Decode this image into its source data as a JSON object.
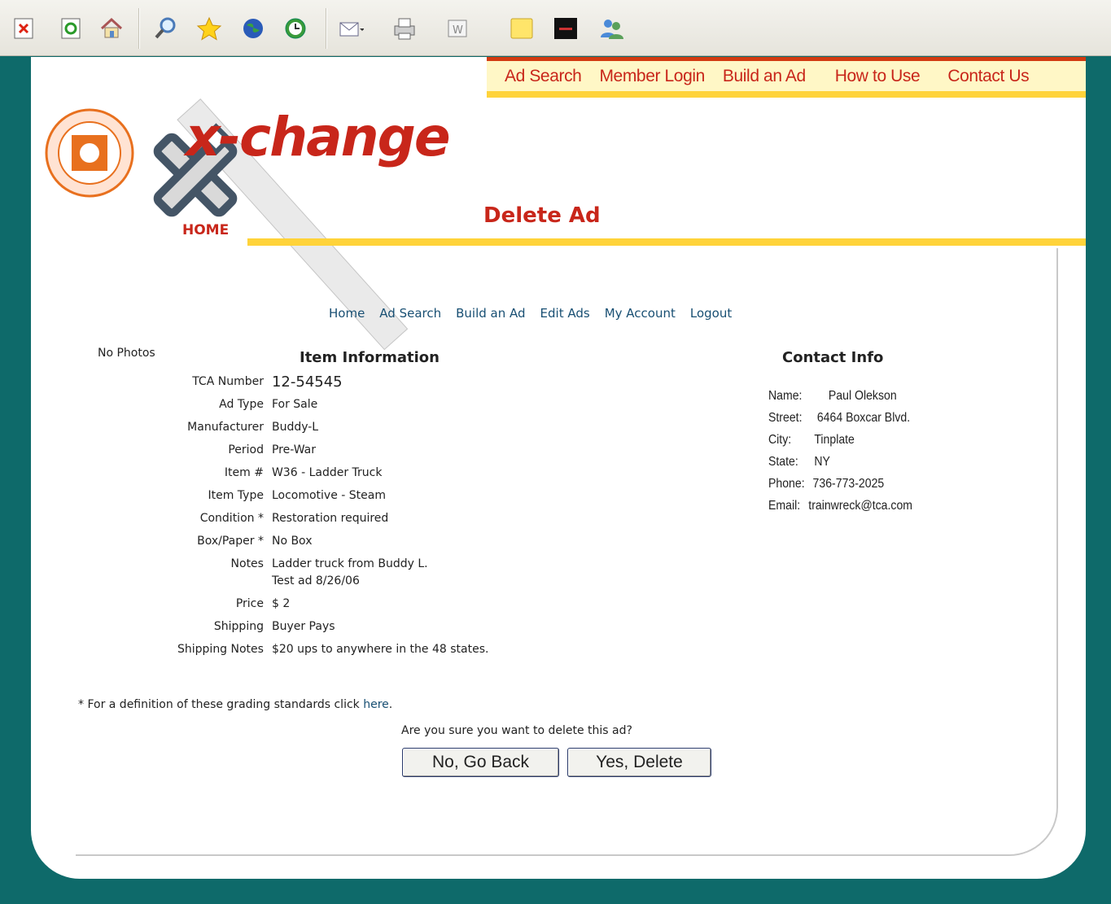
{
  "toolbar": {
    "icons": [
      "stop-icon",
      "refresh-icon",
      "home-icon",
      "search-icon",
      "favorites-icon",
      "media-icon",
      "history-icon",
      "mail-icon",
      "print-icon",
      "edit-icon",
      "notes-icon",
      "messenger-icon",
      "contacts-icon"
    ]
  },
  "topnav": {
    "items": [
      "Ad Search",
      "Member Login",
      "Build an Ad",
      "How to Use",
      "Contact Us"
    ]
  },
  "logo": {
    "text": "x-change",
    "home": "HOME"
  },
  "page_title": "Delete Ad",
  "subnav": {
    "items": [
      "Home",
      "Ad Search",
      "Build an Ad",
      "Edit Ads",
      "My Account",
      "Logout"
    ]
  },
  "photos": "No Photos",
  "item_info": {
    "title": "Item Information",
    "rows": [
      {
        "label": "TCA Number",
        "value": "12-54545"
      },
      {
        "label": "Ad Type",
        "value": "For Sale"
      },
      {
        "label": "Manufacturer",
        "value": "Buddy-L"
      },
      {
        "label": "Period",
        "value": "Pre-War"
      },
      {
        "label": "Item #",
        "value": "W36 - Ladder Truck"
      },
      {
        "label": "Item Type",
        "value": "Locomotive - Steam"
      },
      {
        "label": "Condition *",
        "value": "Restoration required"
      },
      {
        "label": "Box/Paper *",
        "value": "No Box"
      },
      {
        "label": "Notes",
        "value": "Ladder truck from Buddy L.",
        "value2": "Test ad 8/26/06"
      },
      {
        "label": "Price",
        "value": "$ 2"
      },
      {
        "label": "Shipping",
        "value": "Buyer Pays"
      },
      {
        "label": "Shipping Notes",
        "value": "$20 ups to anywhere in the 48 states."
      }
    ]
  },
  "contact": {
    "title": "Contact Info",
    "rows": [
      {
        "label": "Name:",
        "value": "Paul Olekson"
      },
      {
        "label": "Street:",
        "value": "6464 Boxcar Blvd."
      },
      {
        "label": "City:",
        "value": "Tinplate"
      },
      {
        "label": "State:",
        "value": "NY"
      },
      {
        "label": "Phone:",
        "value": "736-773-2025"
      },
      {
        "label": "Email:",
        "value": "trainwreck@tca.com"
      }
    ]
  },
  "footnote": {
    "text": "* For a definition of these grading standards click ",
    "link": "here",
    "end": "."
  },
  "confirm": {
    "question": "Are you sure you want to delete this ad?",
    "no_label": "No, Go Back",
    "yes_label": "Yes, Delete"
  },
  "colors": {
    "brand_red": "#c8261a",
    "accent_yellow": "#ffd33a",
    "frame_teal": "#0e6a6a",
    "link_blue": "#184f73"
  }
}
